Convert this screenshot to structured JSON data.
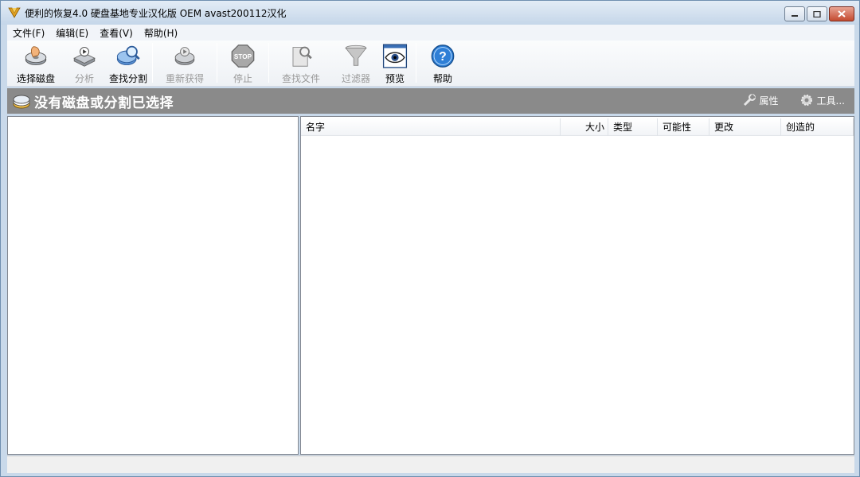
{
  "window": {
    "title": "便利的恢复4.0 硬盘基地专业汉化版 OEM avast200112汉化"
  },
  "menu": [
    {
      "label": "文件(F)"
    },
    {
      "label": "编辑(E)"
    },
    {
      "label": "查看(V)"
    },
    {
      "label": "帮助(H)"
    }
  ],
  "toolbar": {
    "select_disk": "选择磁盘",
    "analyze": "分析",
    "find_partition": "查找分割",
    "recover": "重新获得",
    "stop": "停止",
    "find_file": "查找文件",
    "filter": "过滤器",
    "preview": "预览",
    "help": "帮助"
  },
  "band": {
    "title": "没有磁盘或分割已选择",
    "properties": "属性",
    "tools": "工具..."
  },
  "file_list": {
    "columns": [
      "名字",
      "大小",
      "类型",
      "可能性",
      "更改",
      "创造的"
    ]
  },
  "colors": {
    "band_bg": "#8a8a8a",
    "title_bar": "#c5d6e9",
    "disabled_text": "#9a9a9a"
  }
}
